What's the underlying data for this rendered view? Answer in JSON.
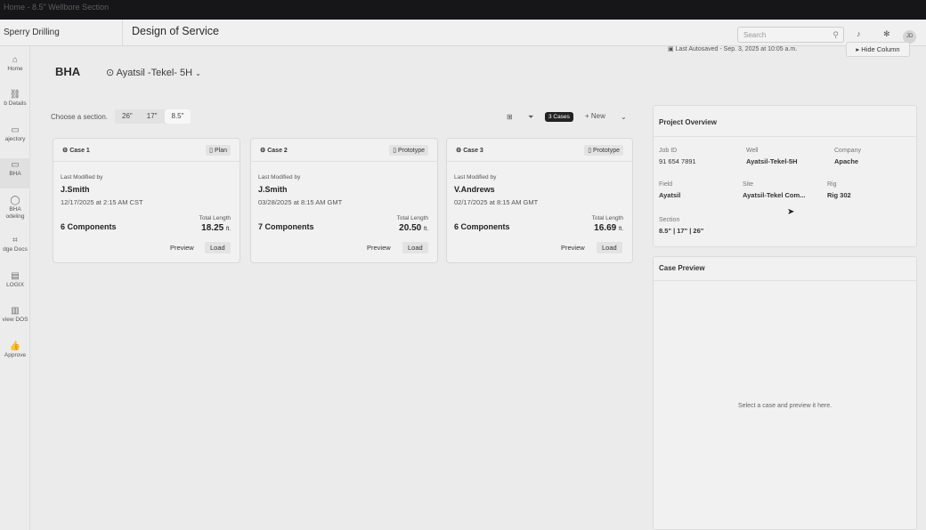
{
  "browser": {
    "tab_title": "Home - 8.5\" Wellbore Section"
  },
  "topbar": {
    "brand": "Sperry Drilling",
    "title": "Design of Service",
    "search_placeholder": "Search",
    "avatar_initials": "JD"
  },
  "sidebar": {
    "items": [
      {
        "label": "Home",
        "icon": "home-icon",
        "glyph": "⌂"
      },
      {
        "label": "b Details",
        "icon": "job-details-icon",
        "glyph": "⛓"
      },
      {
        "label": "ajectory",
        "icon": "trajectory-icon",
        "glyph": "▭"
      },
      {
        "label": "BHA",
        "icon": "bha-icon",
        "glyph": "▭"
      },
      {
        "label": "BHA\nodeling",
        "icon": "bha-modeling-icon",
        "glyph": "◯"
      },
      {
        "label": "dge Docs",
        "icon": "knowledge-docs-icon",
        "glyph": "⌗"
      },
      {
        "label": "LOGIX",
        "icon": "logix-icon",
        "glyph": "▤"
      },
      {
        "label": "view DOS",
        "icon": "review-dos-icon",
        "glyph": "▥"
      },
      {
        "label": "Approve",
        "icon": "thumbs-up-icon",
        "glyph": "👍"
      }
    ]
  },
  "header": {
    "title": "BHA",
    "well": "Ayatsil -Tekel- 5H",
    "autosave": "Last Autosaved - Sep. 3, 2025 at 10:05 a.m.",
    "hide_column": "Hide Column"
  },
  "toolbar": {
    "section_label": "Choose a section.",
    "sections": [
      "26\"",
      "17\"",
      "8.5\""
    ],
    "cases_badge": "3 Cases",
    "new_label": "+ New"
  },
  "cases": [
    {
      "name": "Case 1",
      "type": "Plan",
      "modified_label": "Last Modified by",
      "user": "J.Smith",
      "date": "12/17/2025 at 2:15 AM CST",
      "components": "6 Components",
      "length_label": "Total Length",
      "length": "18.25",
      "unit": "ft.",
      "preview": "Preview",
      "load": "Load"
    },
    {
      "name": "Case 2",
      "type": "Prototype",
      "modified_label": "Last Modified by",
      "user": "J.Smith",
      "date": "03/28/2025 at 8:15 AM GMT",
      "components": "7 Components",
      "length_label": "Total Length",
      "length": "20.50",
      "unit": "ft.",
      "preview": "Preview",
      "load": "Load"
    },
    {
      "name": "Case 3",
      "type": "Prototype",
      "modified_label": "Last Modified by",
      "user": "V.Andrews",
      "date": "02/17/2025 at 8:15 AM GMT",
      "components": "6 Components",
      "length_label": "Total Length",
      "length": "16.69",
      "unit": "ft.",
      "preview": "Preview",
      "load": "Load"
    }
  ],
  "project_overview": {
    "title": "Project Overview",
    "job_id_label": "Job ID",
    "job_id": "91 654 7891",
    "well_label": "Well",
    "well": "Ayatsil-Tekel-5H",
    "company_label": "Company",
    "company": "Apache",
    "field_label": "Field",
    "field": "Ayatsil",
    "site_label": "Site",
    "site": "Ayatsil-Tekel Com...",
    "rig_label": "Rig",
    "rig": "Rig 302",
    "section_label": "Section",
    "section": "8.5\" | 17\" | 26\""
  },
  "case_preview": {
    "title": "Case Preview",
    "empty": "Select a case and preview it here."
  }
}
